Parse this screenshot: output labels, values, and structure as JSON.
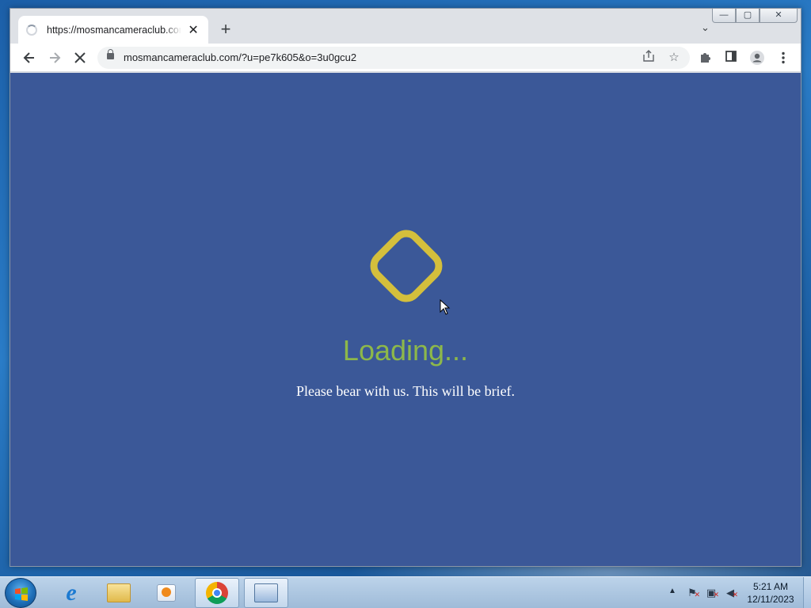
{
  "browser": {
    "tab": {
      "title": "https://mosmancameraclub.com/",
      "close": "✕"
    },
    "new_tab": "+",
    "address": {
      "url": "mosmancameraclub.com/?u=pe7k605&o=3u0gcu2"
    },
    "window_controls": {
      "minimize": "—",
      "restore": "▢",
      "close": "✕"
    }
  },
  "page": {
    "heading": "Loading...",
    "subtext": "Please bear with us. This will be brief.",
    "background_color": "#3b5898",
    "loader_color": "#d4bf3c",
    "heading_color": "#8db84a"
  },
  "taskbar": {
    "apps": [
      {
        "name": "Internet Explorer",
        "icon": "ie-icon"
      },
      {
        "name": "Windows Explorer",
        "icon": "folder-icon"
      },
      {
        "name": "Windows Media Player",
        "icon": "media-player-icon"
      },
      {
        "name": "Google Chrome",
        "icon": "chrome-icon"
      },
      {
        "name": "Control Panel",
        "icon": "control-panel-icon"
      }
    ],
    "clock": {
      "time": "5:21 AM",
      "date": "12/11/2023"
    }
  }
}
